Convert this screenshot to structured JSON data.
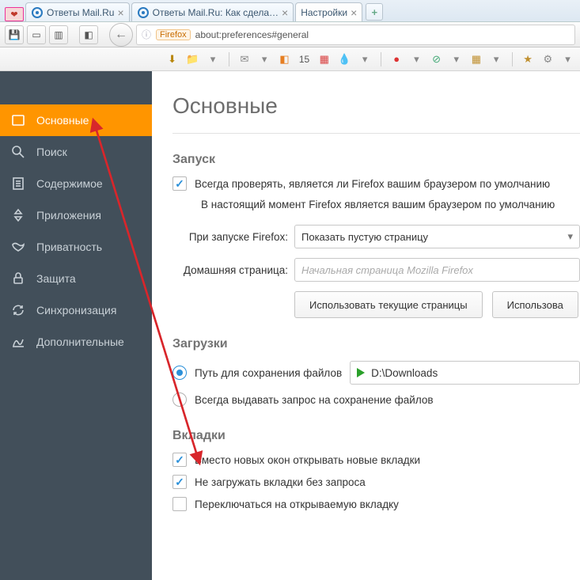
{
  "tabs": [
    {
      "label": "Ответы Mail.Ru"
    },
    {
      "label": "Ответы Mail.Ru: Как сдела…"
    },
    {
      "label": "Настройки"
    }
  ],
  "address": {
    "pill": "Firefox",
    "url": "about:preferences#general"
  },
  "iconrow_badge": "15",
  "sidebar": {
    "items": [
      {
        "label": "Основные"
      },
      {
        "label": "Поиск"
      },
      {
        "label": "Содержимое"
      },
      {
        "label": "Приложения"
      },
      {
        "label": "Приватность"
      },
      {
        "label": "Защита"
      },
      {
        "label": "Синхронизация"
      },
      {
        "label": "Дополнительные"
      }
    ]
  },
  "page": {
    "title": "Основные",
    "startup": {
      "heading": "Запуск",
      "default_check": "Всегда проверять, является ли Firefox вашим браузером по умолчанию",
      "default_note": "В настоящий момент Firefox является вашим браузером по умолчанию",
      "on_start_label": "При запуске Firefox:",
      "on_start_value": "Показать пустую страницу",
      "home_label": "Домашняя страница:",
      "home_placeholder": "Начальная страница Mozilla Firefox",
      "btn_use_current": "Использовать текущие страницы",
      "btn_use_bookmark": "Использова"
    },
    "downloads": {
      "heading": "Загрузки",
      "opt_path": "Путь для сохранения файлов",
      "path_value": "D:\\Downloads",
      "opt_ask": "Всегда выдавать запрос на сохранение файлов"
    },
    "tabs_section": {
      "heading": "Вкладки",
      "opt_newwin": "Вместо новых окон открывать новые вкладки",
      "opt_noload": "Не загружать вкладки без запроса",
      "opt_switch": "Переключаться на открываемую вкладку"
    }
  }
}
